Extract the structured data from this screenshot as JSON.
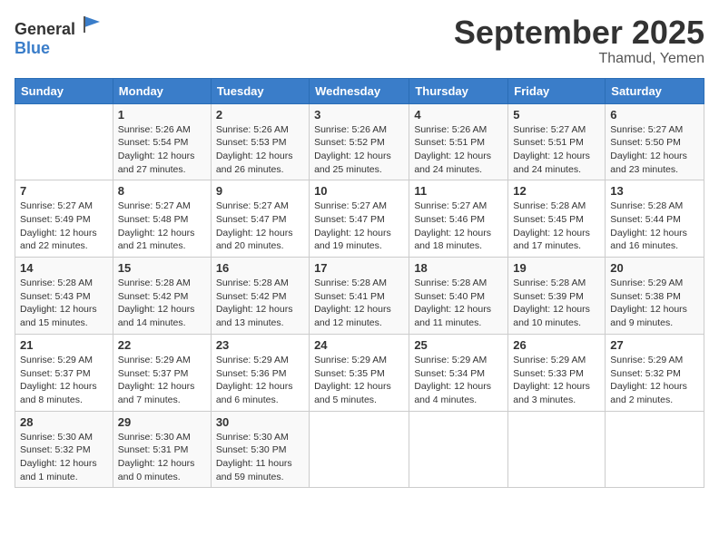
{
  "logo": {
    "general": "General",
    "blue": "Blue"
  },
  "title": "September 2025",
  "location": "Thamud, Yemen",
  "days_of_week": [
    "Sunday",
    "Monday",
    "Tuesday",
    "Wednesday",
    "Thursday",
    "Friday",
    "Saturday"
  ],
  "weeks": [
    [
      {
        "day": "",
        "sunrise": "",
        "sunset": "",
        "daylight": ""
      },
      {
        "day": "1",
        "sunrise": "Sunrise: 5:26 AM",
        "sunset": "Sunset: 5:54 PM",
        "daylight": "Daylight: 12 hours and 27 minutes."
      },
      {
        "day": "2",
        "sunrise": "Sunrise: 5:26 AM",
        "sunset": "Sunset: 5:53 PM",
        "daylight": "Daylight: 12 hours and 26 minutes."
      },
      {
        "day": "3",
        "sunrise": "Sunrise: 5:26 AM",
        "sunset": "Sunset: 5:52 PM",
        "daylight": "Daylight: 12 hours and 25 minutes."
      },
      {
        "day": "4",
        "sunrise": "Sunrise: 5:26 AM",
        "sunset": "Sunset: 5:51 PM",
        "daylight": "Daylight: 12 hours and 24 minutes."
      },
      {
        "day": "5",
        "sunrise": "Sunrise: 5:27 AM",
        "sunset": "Sunset: 5:51 PM",
        "daylight": "Daylight: 12 hours and 24 minutes."
      },
      {
        "day": "6",
        "sunrise": "Sunrise: 5:27 AM",
        "sunset": "Sunset: 5:50 PM",
        "daylight": "Daylight: 12 hours and 23 minutes."
      }
    ],
    [
      {
        "day": "7",
        "sunrise": "Sunrise: 5:27 AM",
        "sunset": "Sunset: 5:49 PM",
        "daylight": "Daylight: 12 hours and 22 minutes."
      },
      {
        "day": "8",
        "sunrise": "Sunrise: 5:27 AM",
        "sunset": "Sunset: 5:48 PM",
        "daylight": "Daylight: 12 hours and 21 minutes."
      },
      {
        "day": "9",
        "sunrise": "Sunrise: 5:27 AM",
        "sunset": "Sunset: 5:47 PM",
        "daylight": "Daylight: 12 hours and 20 minutes."
      },
      {
        "day": "10",
        "sunrise": "Sunrise: 5:27 AM",
        "sunset": "Sunset: 5:47 PM",
        "daylight": "Daylight: 12 hours and 19 minutes."
      },
      {
        "day": "11",
        "sunrise": "Sunrise: 5:27 AM",
        "sunset": "Sunset: 5:46 PM",
        "daylight": "Daylight: 12 hours and 18 minutes."
      },
      {
        "day": "12",
        "sunrise": "Sunrise: 5:28 AM",
        "sunset": "Sunset: 5:45 PM",
        "daylight": "Daylight: 12 hours and 17 minutes."
      },
      {
        "day": "13",
        "sunrise": "Sunrise: 5:28 AM",
        "sunset": "Sunset: 5:44 PM",
        "daylight": "Daylight: 12 hours and 16 minutes."
      }
    ],
    [
      {
        "day": "14",
        "sunrise": "Sunrise: 5:28 AM",
        "sunset": "Sunset: 5:43 PM",
        "daylight": "Daylight: 12 hours and 15 minutes."
      },
      {
        "day": "15",
        "sunrise": "Sunrise: 5:28 AM",
        "sunset": "Sunset: 5:42 PM",
        "daylight": "Daylight: 12 hours and 14 minutes."
      },
      {
        "day": "16",
        "sunrise": "Sunrise: 5:28 AM",
        "sunset": "Sunset: 5:42 PM",
        "daylight": "Daylight: 12 hours and 13 minutes."
      },
      {
        "day": "17",
        "sunrise": "Sunrise: 5:28 AM",
        "sunset": "Sunset: 5:41 PM",
        "daylight": "Daylight: 12 hours and 12 minutes."
      },
      {
        "day": "18",
        "sunrise": "Sunrise: 5:28 AM",
        "sunset": "Sunset: 5:40 PM",
        "daylight": "Daylight: 12 hours and 11 minutes."
      },
      {
        "day": "19",
        "sunrise": "Sunrise: 5:28 AM",
        "sunset": "Sunset: 5:39 PM",
        "daylight": "Daylight: 12 hours and 10 minutes."
      },
      {
        "day": "20",
        "sunrise": "Sunrise: 5:29 AM",
        "sunset": "Sunset: 5:38 PM",
        "daylight": "Daylight: 12 hours and 9 minutes."
      }
    ],
    [
      {
        "day": "21",
        "sunrise": "Sunrise: 5:29 AM",
        "sunset": "Sunset: 5:37 PM",
        "daylight": "Daylight: 12 hours and 8 minutes."
      },
      {
        "day": "22",
        "sunrise": "Sunrise: 5:29 AM",
        "sunset": "Sunset: 5:37 PM",
        "daylight": "Daylight: 12 hours and 7 minutes."
      },
      {
        "day": "23",
        "sunrise": "Sunrise: 5:29 AM",
        "sunset": "Sunset: 5:36 PM",
        "daylight": "Daylight: 12 hours and 6 minutes."
      },
      {
        "day": "24",
        "sunrise": "Sunrise: 5:29 AM",
        "sunset": "Sunset: 5:35 PM",
        "daylight": "Daylight: 12 hours and 5 minutes."
      },
      {
        "day": "25",
        "sunrise": "Sunrise: 5:29 AM",
        "sunset": "Sunset: 5:34 PM",
        "daylight": "Daylight: 12 hours and 4 minutes."
      },
      {
        "day": "26",
        "sunrise": "Sunrise: 5:29 AM",
        "sunset": "Sunset: 5:33 PM",
        "daylight": "Daylight: 12 hours and 3 minutes."
      },
      {
        "day": "27",
        "sunrise": "Sunrise: 5:29 AM",
        "sunset": "Sunset: 5:32 PM",
        "daylight": "Daylight: 12 hours and 2 minutes."
      }
    ],
    [
      {
        "day": "28",
        "sunrise": "Sunrise: 5:30 AM",
        "sunset": "Sunset: 5:32 PM",
        "daylight": "Daylight: 12 hours and 1 minute."
      },
      {
        "day": "29",
        "sunrise": "Sunrise: 5:30 AM",
        "sunset": "Sunset: 5:31 PM",
        "daylight": "Daylight: 12 hours and 0 minutes."
      },
      {
        "day": "30",
        "sunrise": "Sunrise: 5:30 AM",
        "sunset": "Sunset: 5:30 PM",
        "daylight": "Daylight: 11 hours and 59 minutes."
      },
      {
        "day": "",
        "sunrise": "",
        "sunset": "",
        "daylight": ""
      },
      {
        "day": "",
        "sunrise": "",
        "sunset": "",
        "daylight": ""
      },
      {
        "day": "",
        "sunrise": "",
        "sunset": "",
        "daylight": ""
      },
      {
        "day": "",
        "sunrise": "",
        "sunset": "",
        "daylight": ""
      }
    ]
  ]
}
